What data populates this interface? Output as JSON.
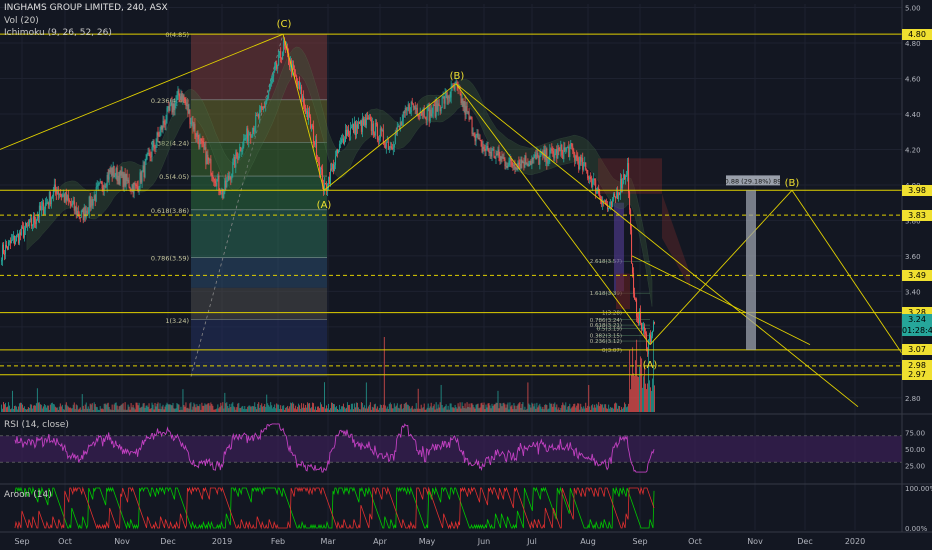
{
  "header": {
    "symbol_line": "INGHAMS GROUP LIMITED, 240, ASX",
    "vol_label": "Vol (20)",
    "ichimoku_label": "Ichimoku (9, 26, 52, 26)",
    "rsi_label": "RSI (14, close)",
    "aroon_label": "Aroon (14)"
  },
  "colors": {
    "background": "#131722",
    "up": "#26a69a",
    "down": "#ef5350",
    "fib_line": "#e0d000",
    "rsi": "#c040c0",
    "rsi_band": "#3a1f55",
    "aroon_up": "#00c800",
    "aroon_down": "#e03030"
  },
  "chart_data": {
    "type": "candlestick",
    "x_ticks": [
      "Sep",
      "Oct",
      "Nov",
      "Dec",
      "2019",
      "Feb",
      "Mar",
      "Apr",
      "May",
      "Jun",
      "Jul",
      "Aug",
      "Sep",
      "Oct",
      "Nov",
      "Dec",
      "2020"
    ],
    "y_ticks": [
      "5.00",
      "4.80",
      "4.60",
      "4.40",
      "4.20",
      "4.00",
      "3.80",
      "3.60",
      "3.40",
      "3.20",
      "3.00",
      "2.80"
    ],
    "ylim": [
      2.72,
      5.02
    ],
    "price_tags": [
      {
        "label": "4.80",
        "value": 4.85,
        "bg": "#f0e030"
      },
      {
        "label": "3.98",
        "value": 3.97,
        "bg": "#f0e030"
      },
      {
        "label": "3.83",
        "value": 3.83,
        "bg": "#f0e030"
      },
      {
        "label": "3.49",
        "value": 3.49,
        "bg": "#f0e030"
      },
      {
        "label": "3.28",
        "value": 3.28,
        "bg": "#f0e030"
      },
      {
        "label": "3.24",
        "value": 3.24,
        "bg": "#26a69a"
      },
      {
        "label": "01:28:48",
        "value": 3.18,
        "bg": "#26a69a"
      },
      {
        "label": "3.07",
        "value": 3.07,
        "bg": "#f0e030"
      },
      {
        "label": "2.98",
        "value": 2.98,
        "bg": "#f0e030"
      },
      {
        "label": "2.97",
        "value": 2.93,
        "bg": "#f0e030"
      }
    ],
    "fib_labels": [
      {
        "text": "0(4.85)",
        "value": 4.85
      },
      {
        "text": "0.236(4.48)",
        "value": 4.48
      },
      {
        "text": "0.382(4.24)",
        "value": 4.24
      },
      {
        "text": "0.5(4.05)",
        "value": 4.05
      },
      {
        "text": "0.618(3.86)",
        "value": 3.86
      },
      {
        "text": "0.786(3.59)",
        "value": 3.59
      },
      {
        "text": "1(3.24)",
        "value": 3.24
      }
    ],
    "fib2_labels": [
      {
        "text": "2.618(3.57)",
        "value": 3.57
      },
      {
        "text": "1.618(3.39)",
        "value": 3.39
      },
      {
        "text": "1(3.28)",
        "value": 3.28
      },
      {
        "text": "0.786(3.24)",
        "value": 3.24
      },
      {
        "text": "0.618(3.21)",
        "value": 3.21
      },
      {
        "text": "0.5(3.19)",
        "value": 3.19
      },
      {
        "text": "0.382(3.15)",
        "value": 3.15
      },
      {
        "text": "0.236(3.12)",
        "value": 3.12
      },
      {
        "text": "0(3.07)",
        "value": 3.07
      }
    ],
    "wave_labels": [
      {
        "text": "(C)",
        "value": 4.9
      },
      {
        "text": "(A)",
        "value": 3.93
      },
      {
        "text": "(B)",
        "value": 4.6
      },
      {
        "text": "(A)",
        "value": 2.98
      },
      {
        "text": "(B)",
        "value": 4.02
      }
    ],
    "projection_label": "0.88 (29.18%) 89",
    "rsi_ticks": [
      "75.00",
      "50.00",
      "25.00"
    ],
    "aroon_ticks": [
      "100.00%",
      "0.00%"
    ],
    "anchors": [
      {
        "t": 0,
        "v": 3.62
      },
      {
        "t": 30,
        "v": 3.78
      },
      {
        "t": 55,
        "v": 3.98
      },
      {
        "t": 80,
        "v": 3.82
      },
      {
        "t": 110,
        "v": 4.08
      },
      {
        "t": 135,
        "v": 3.98
      },
      {
        "t": 165,
        "v": 4.38
      },
      {
        "t": 180,
        "v": 4.52
      },
      {
        "t": 200,
        "v": 4.22
      },
      {
        "t": 222,
        "v": 3.95
      },
      {
        "t": 240,
        "v": 4.22
      },
      {
        "t": 262,
        "v": 4.42
      },
      {
        "t": 283,
        "v": 4.78
      },
      {
        "t": 300,
        "v": 4.52
      },
      {
        "t": 312,
        "v": 4.3
      },
      {
        "t": 324,
        "v": 3.97
      },
      {
        "t": 345,
        "v": 4.3
      },
      {
        "t": 368,
        "v": 4.35
      },
      {
        "t": 390,
        "v": 4.22
      },
      {
        "t": 410,
        "v": 4.45
      },
      {
        "t": 430,
        "v": 4.4
      },
      {
        "t": 456,
        "v": 4.55
      },
      {
        "t": 480,
        "v": 4.22
      },
      {
        "t": 510,
        "v": 4.12
      },
      {
        "t": 540,
        "v": 4.15
      },
      {
        "t": 570,
        "v": 4.2
      },
      {
        "t": 590,
        "v": 4.05
      },
      {
        "t": 610,
        "v": 3.85
      },
      {
        "t": 628,
        "v": 4.1
      },
      {
        "t": 634,
        "v": 3.35
      },
      {
        "t": 648,
        "v": 3.1
      },
      {
        "t": 655,
        "v": 3.22
      }
    ]
  }
}
